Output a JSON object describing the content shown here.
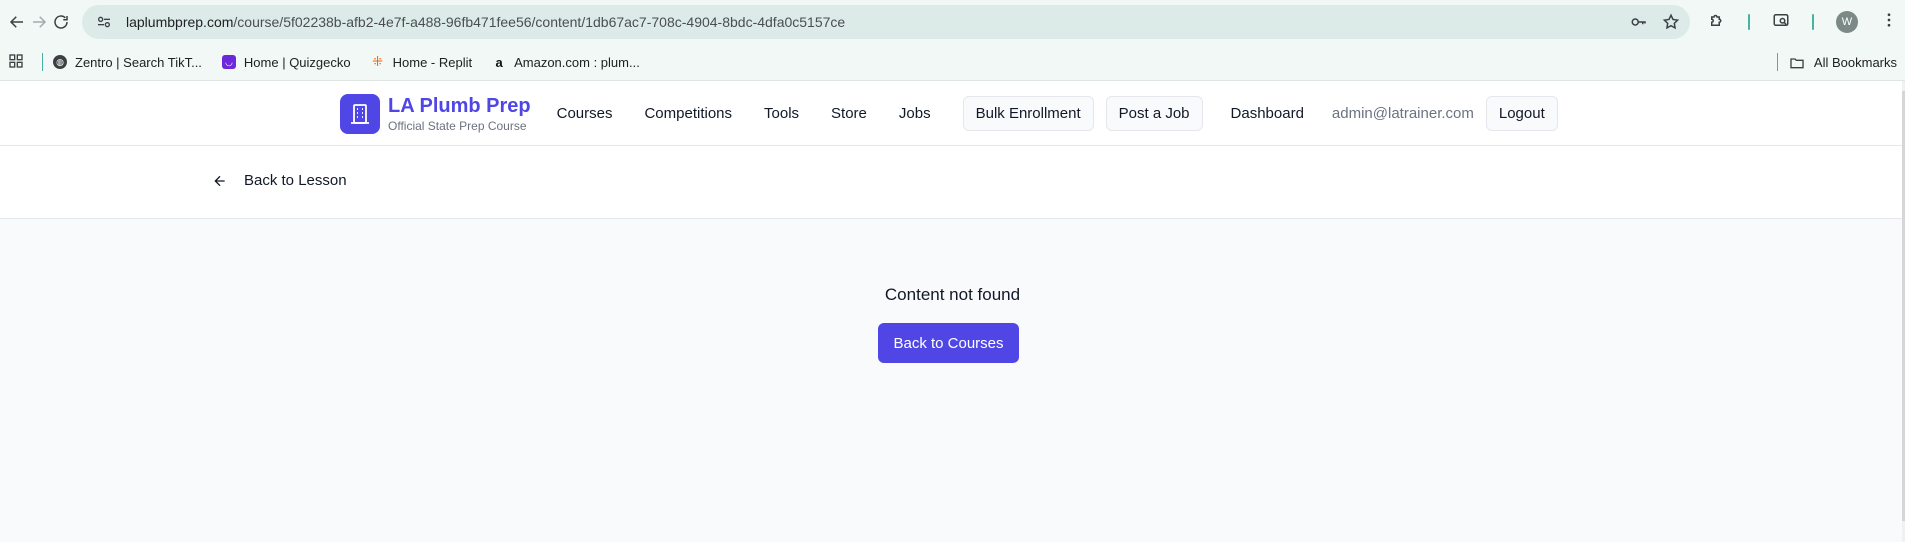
{
  "browser": {
    "url_domain": "laplumbprep.com",
    "url_path": "/course/5f02238b-afb2-4e7f-a488-96fb471fee56/content/1db67ac7-708c-4904-8bdc-4dfa0c5157ce",
    "profile_initial": "W",
    "bookmarks": [
      {
        "label": "Zentro | Search TikT...",
        "icon_color": "#3c4043"
      },
      {
        "label": "Home | Quizgecko",
        "icon_color": "#6d28d9"
      },
      {
        "label": "Home - Replit",
        "icon_color": "#f26207"
      },
      {
        "label": "Amazon.com : plum...",
        "icon_color": "#111111"
      }
    ],
    "all_bookmarks_label": "All Bookmarks"
  },
  "site": {
    "brand_title": "LA Plumb Prep",
    "brand_subtitle": "Official State Prep Course",
    "brand_color": "#4f46e5",
    "nav": {
      "courses": "Courses",
      "competitions": "Competitions",
      "tools": "Tools",
      "store": "Store",
      "jobs": "Jobs",
      "bulk_enrollment": "Bulk Enrollment",
      "post_job": "Post a Job",
      "dashboard": "Dashboard",
      "user_email": "admin@latrainer.com",
      "logout": "Logout"
    }
  },
  "subbar": {
    "back_label": "Back to Lesson"
  },
  "main": {
    "message": "Content not found",
    "button_label": "Back to Courses"
  }
}
